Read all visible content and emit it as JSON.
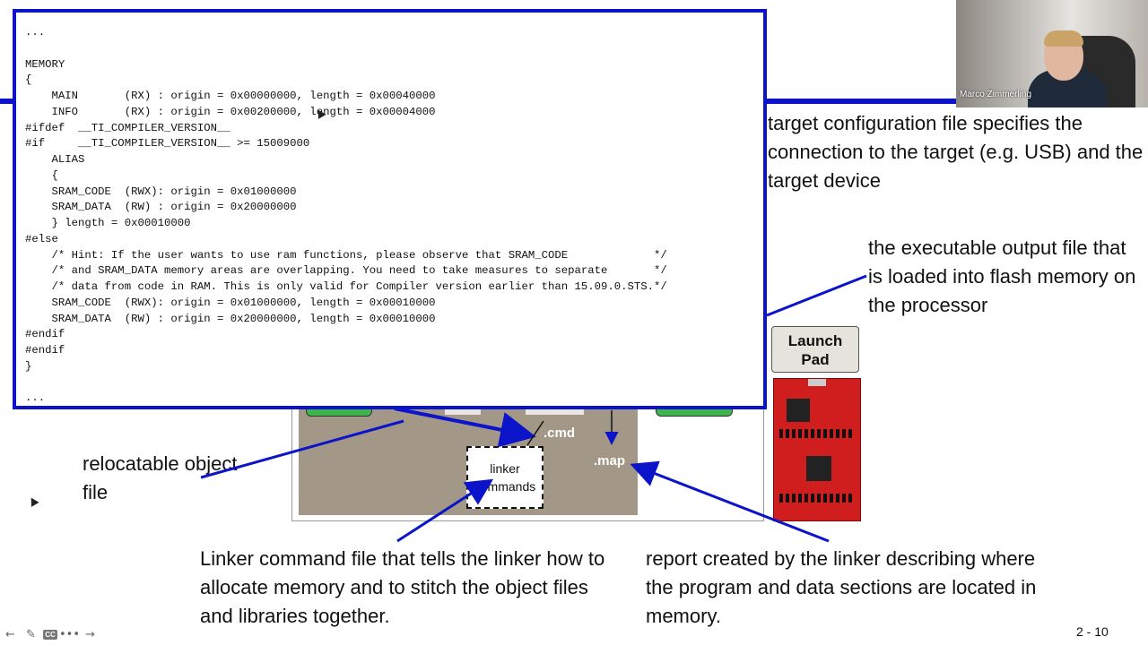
{
  "code_window": {
    "lines": [
      "...",
      "",
      "MEMORY",
      "{",
      "    MAIN       (RX) : origin = 0x00000000, length = 0x00040000",
      "    INFO       (RX) : origin = 0x00200000, length = 0x00004000",
      "#ifdef  __TI_COMPILER_VERSION__",
      "#if     __TI_COMPILER_VERSION__ >= 15009000",
      "    ALIAS",
      "    {",
      "    SRAM_CODE  (RWX): origin = 0x01000000",
      "    SRAM_DATA  (RW) : origin = 0x20000000",
      "    } length = 0x00010000",
      "#else",
      "    /* Hint: If the user wants to use ram functions, please observe that SRAM_CODE             */",
      "    /* and SRAM_DATA memory areas are overlapping. You need to take measures to separate       */",
      "    /* data from code in RAM. This is only valid for Compiler version earlier than 15.09.0.STS.*/",
      "    SRAM_CODE  (RWX): origin = 0x01000000, length = 0x00010000",
      "    SRAM_DATA  (RW) : origin = 0x20000000, length = 0x00010000",
      "#endif",
      "#endif",
      "}",
      "",
      "..."
    ]
  },
  "slide": {
    "target_config_text": "target configuration file specifies the connection to the target (e.g. USB) and the target device",
    "executable_text": "the executable output file that is loaded into flash memory on the processor",
    "relocatable_text": "relocatable object file",
    "linker_command_text": "Linker command file that tells the linker how to allocate memory and to stitch the object files and libraries together.",
    "report_text": "report created by the linker describing where the program and data sections are located in memory.",
    "page_number": "2 - 10"
  },
  "diagram": {
    "cmd_label": ".cmd",
    "map_label": ".map",
    "linker_box_line1": "linker",
    "linker_box_line2": "commands",
    "launchpad_line1": "Launch",
    "launchpad_line2": "Pad"
  },
  "video": {
    "presenter_name": "Marco Zimmerling"
  },
  "controls": {
    "icons": [
      "back-icon",
      "pen-icon",
      "cc-icon",
      "more-icon",
      "forward-icon"
    ],
    "cc_label": "CC"
  },
  "colors": {
    "accent_blue": "#0b14c8",
    "diagram_brown": "#a39787",
    "board_red": "#d01d1d",
    "green": "#3db54a"
  }
}
